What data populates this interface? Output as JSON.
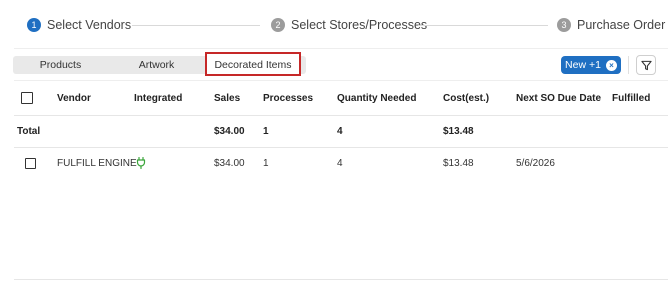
{
  "stepper": {
    "steps": [
      {
        "number": "1",
        "label": "Select Vendors"
      },
      {
        "number": "2",
        "label": "Select Stores/Processes"
      },
      {
        "number": "3",
        "label": "Purchase Order"
      }
    ]
  },
  "tabs": {
    "items": [
      {
        "label": "Products"
      },
      {
        "label": "Artwork"
      },
      {
        "label": "Decorated Items"
      }
    ],
    "active": "Decorated Items"
  },
  "toolbar": {
    "new_button_label": "New +1",
    "new_button_close_glyph": "×",
    "filter_icon": "filter-icon"
  },
  "table": {
    "columns": [
      "Vendor",
      "Integrated",
      "Sales",
      "Processes",
      "Quantity Needed",
      "Cost(est.)",
      "Next SO Due Date",
      "Fulfilled"
    ],
    "total": {
      "label": "Total",
      "sales": "$34.00",
      "processes": "1",
      "quantity_needed": "4",
      "cost": "$13.48"
    },
    "rows": [
      {
        "vendor": "FULFILL ENGINE",
        "integrated_icon": "plug-icon",
        "sales": "$34.00",
        "processes": "1",
        "quantity_needed": "4",
        "cost": "$13.48",
        "next_so_due_date": "5/6/2026",
        "fulfilled": ""
      }
    ]
  },
  "colors": {
    "accent": "#1f6fc2",
    "highlight_border": "#c62828",
    "integrated_icon": "#3aa53a"
  }
}
